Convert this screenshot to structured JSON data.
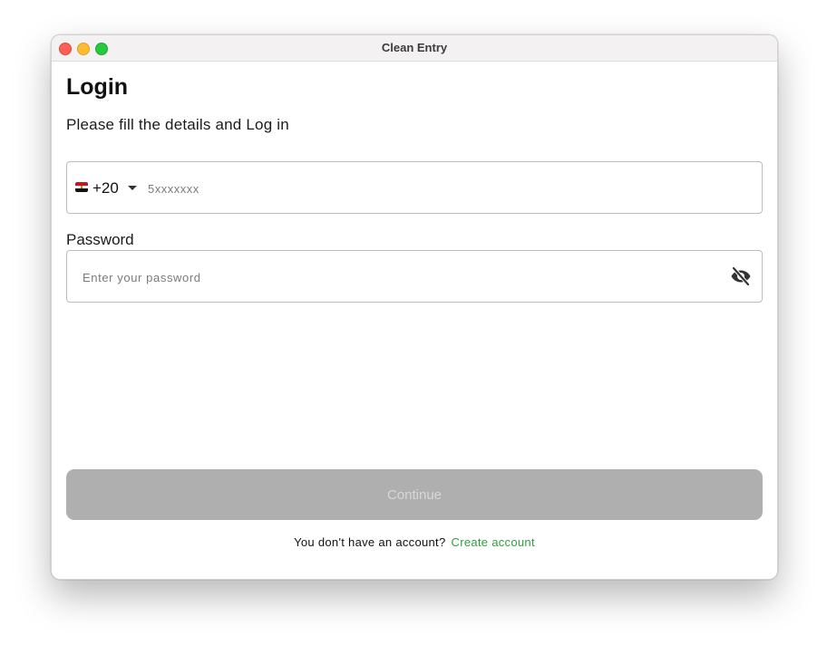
{
  "window": {
    "title": "Clean Entry"
  },
  "login": {
    "heading": "Login",
    "subtitle": "Please fill the details and Log in"
  },
  "phone": {
    "country_flag": "egypt-flag",
    "dial_code": "+20",
    "placeholder": "5xxxxxxx",
    "value": ""
  },
  "password": {
    "label": "Password",
    "placeholder": "Enter your password",
    "value": "",
    "visibility_icon": "eye-off-icon"
  },
  "actions": {
    "continue_label": "Continue",
    "continue_enabled": false
  },
  "footer": {
    "prompt": "You don't have an account?",
    "link_label": "Create account",
    "link_color": "#2f9e3f"
  },
  "colors": {
    "button_disabled_bg": "#afafaf",
    "button_disabled_text": "#d7d7d7"
  }
}
